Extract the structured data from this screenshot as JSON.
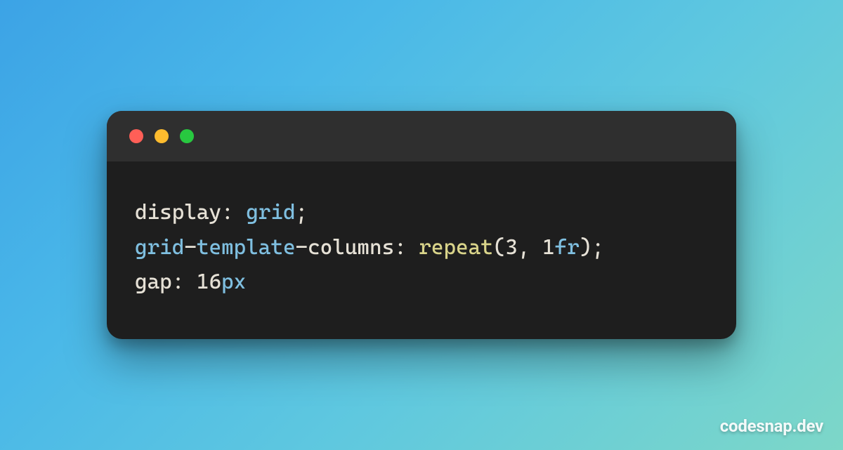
{
  "window": {
    "traffic_lights": {
      "close": {
        "name": "close",
        "color": "#ff5f57"
      },
      "min": {
        "name": "minimize",
        "color": "#febc2e"
      },
      "max": {
        "name": "maximize",
        "color": "#28c840"
      }
    }
  },
  "code": {
    "lines": [
      {
        "property": "display",
        "colon": ": ",
        "tokens": [
          {
            "text": "grid",
            "cls": "tok-kw"
          },
          {
            "text": ";",
            "cls": "tok-semi"
          }
        ]
      },
      {
        "property_parts": [
          {
            "text": "grid",
            "cls": "tok-kw"
          },
          {
            "text": "-",
            "cls": "tok-dash"
          },
          {
            "text": "template",
            "cls": "tok-kw"
          },
          {
            "text": "-",
            "cls": "tok-dash"
          },
          {
            "text": "columns",
            "cls": "tok-prop"
          }
        ],
        "colon": ": ",
        "tokens": [
          {
            "text": "repeat",
            "cls": "tok-func"
          },
          {
            "text": "(",
            "cls": "tok-paren"
          },
          {
            "text": "3",
            "cls": "tok-num"
          },
          {
            "text": ", ",
            "cls": "tok-sep"
          },
          {
            "text": "1",
            "cls": "tok-num"
          },
          {
            "text": "fr",
            "cls": "tok-unit"
          },
          {
            "text": ")",
            "cls": "tok-paren"
          },
          {
            "text": ";",
            "cls": "tok-semi"
          }
        ]
      },
      {
        "property": "gap",
        "colon": ": ",
        "tokens": [
          {
            "text": "16",
            "cls": "tok-num"
          },
          {
            "text": "px",
            "cls": "tok-unit"
          }
        ]
      }
    ]
  },
  "watermark": "codesnap.dev"
}
